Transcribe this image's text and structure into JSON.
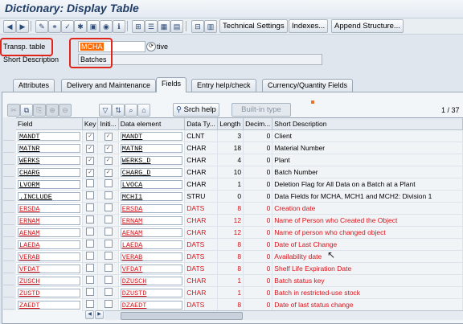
{
  "window": {
    "title": "Dictionary: Display Table"
  },
  "toolbar": {
    "technical_settings": "Technical Settings",
    "indexes": "Indexes...",
    "append_structure": "Append Structure..."
  },
  "header": {
    "table_label": "Transp. table",
    "table_value": "MCHA",
    "status_text": "tive",
    "short_desc_label": "Short Description",
    "short_desc_value": "Batches"
  },
  "tabs": [
    {
      "label": "Attributes"
    },
    {
      "label": "Delivery and Maintenance"
    },
    {
      "label": "Fields"
    },
    {
      "label": "Entry help/check"
    },
    {
      "label": "Currency/Quantity Fields"
    }
  ],
  "grid_toolbar": {
    "search_help": "Srch help",
    "builtin_type": "Built-in type",
    "page": "1 / 37"
  },
  "grid": {
    "columns": [
      "Field",
      "Key",
      "Initi...",
      "Data element",
      "Data Ty...",
      "Length",
      "Decim...",
      "Short Description"
    ],
    "rows": [
      {
        "field": "MANDT",
        "key": true,
        "init": true,
        "elem": "MANDT",
        "type": "CLNT",
        "len": "3",
        "dec": "0",
        "desc": "Client",
        "red": false
      },
      {
        "field": "MATNR",
        "key": true,
        "init": true,
        "elem": "MATNR",
        "type": "CHAR",
        "len": "18",
        "dec": "0",
        "desc": "Material Number",
        "red": false
      },
      {
        "field": "WERKS",
        "key": true,
        "init": true,
        "elem": "WERKS_D",
        "type": "CHAR",
        "len": "4",
        "dec": "0",
        "desc": "Plant",
        "red": false
      },
      {
        "field": "CHARG",
        "key": true,
        "init": true,
        "elem": "CHARG_D",
        "type": "CHAR",
        "len": "10",
        "dec": "0",
        "desc": "Batch Number",
        "red": false
      },
      {
        "field": "LVORM",
        "key": false,
        "init": false,
        "elem": "LVOCA",
        "type": "CHAR",
        "len": "1",
        "dec": "0",
        "desc": "Deletion Flag for All Data on a Batch at a Plant",
        "red": false
      },
      {
        "field": ".INCLUDE",
        "key": false,
        "init": false,
        "elem": "MCHI1",
        "type": "STRU",
        "len": "0",
        "dec": "0",
        "desc": "Data Fields for MCHA, MCH1 and MCH2: Division 1",
        "red": false
      },
      {
        "field": "ERSDA",
        "key": false,
        "init": false,
        "elem": "ERSDA",
        "type": "DATS",
        "len": "8",
        "dec": "0",
        "desc": "Creation date",
        "red": true
      },
      {
        "field": "ERNAM",
        "key": false,
        "init": false,
        "elem": "ERNAM",
        "type": "CHAR",
        "len": "12",
        "dec": "0",
        "desc": "Name of Person who Created the Object",
        "red": true
      },
      {
        "field": "AENAM",
        "key": false,
        "init": false,
        "elem": "AENAM",
        "type": "CHAR",
        "len": "12",
        "dec": "0",
        "desc": "Name of person who changed object",
        "red": true
      },
      {
        "field": "LAEDA",
        "key": false,
        "init": false,
        "elem": "LAEDA",
        "type": "DATS",
        "len": "8",
        "dec": "0",
        "desc": "Date of Last Change",
        "red": true
      },
      {
        "field": "VERAB",
        "key": false,
        "init": false,
        "elem": "VERAB",
        "type": "DATS",
        "len": "8",
        "dec": "0",
        "desc": "Availability date",
        "red": true
      },
      {
        "field": "VFDAT",
        "key": false,
        "init": false,
        "elem": "VFDAT",
        "type": "DATS",
        "len": "8",
        "dec": "0",
        "desc": "Shelf Life Expiration Date",
        "red": true
      },
      {
        "field": "ZUSCH",
        "key": false,
        "init": false,
        "elem": "DZUSCH",
        "type": "CHAR",
        "len": "1",
        "dec": "0",
        "desc": "Batch status key",
        "red": true
      },
      {
        "field": "ZUSTD",
        "key": false,
        "init": false,
        "elem": "DZUSTD",
        "type": "CHAR",
        "len": "1",
        "dec": "0",
        "desc": "Batch in restricted-use stock",
        "red": true
      },
      {
        "field": "ZAEDT",
        "key": false,
        "init": false,
        "elem": "DZAEDT",
        "type": "DATS",
        "len": "8",
        "dec": "0",
        "desc": "Date of last status change",
        "red": true
      }
    ]
  },
  "colors": {
    "title": "#1f3c66",
    "highlight": "#e0251b",
    "red_text": "#d8141a",
    "field_value_bg": "#ff6a00"
  }
}
